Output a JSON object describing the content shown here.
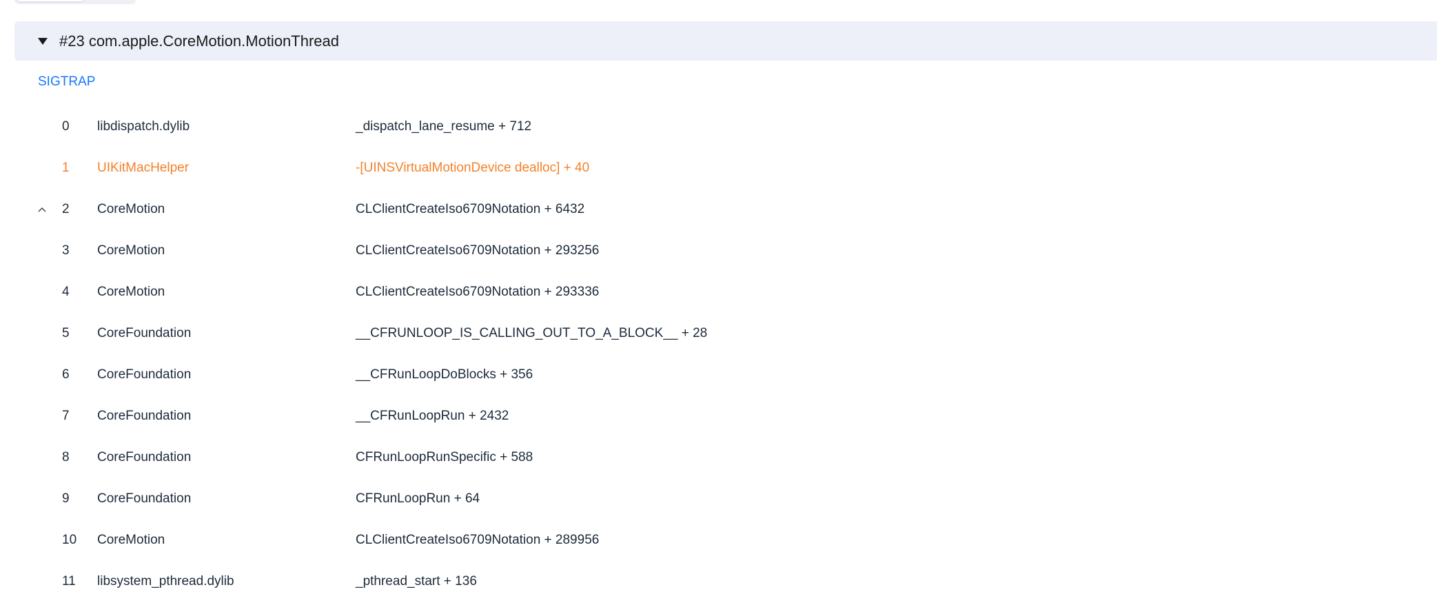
{
  "thread": {
    "title": "#23 com.apple.CoreMotion.MotionThread",
    "signal": "SIGTRAP"
  },
  "colors": {
    "highlight": "#f5812a",
    "link": "#1677ff",
    "header_bg": "#edf0f8"
  },
  "frames": [
    {
      "index": "0",
      "library": "libdispatch.dylib",
      "symbol": "_dispatch_lane_resume + 712"
    },
    {
      "index": "1",
      "library": "UIKitMacHelper",
      "symbol": "-[UINSVirtualMotionDevice dealloc] + 40",
      "highlighted": true
    },
    {
      "index": "2",
      "library": "CoreMotion",
      "symbol": "CLClientCreateIso6709Notation + 6432",
      "collapse_icon": "chevron-up-icon"
    },
    {
      "index": "3",
      "library": "CoreMotion",
      "symbol": "CLClientCreateIso6709Notation + 293256"
    },
    {
      "index": "4",
      "library": "CoreMotion",
      "symbol": "CLClientCreateIso6709Notation + 293336"
    },
    {
      "index": "5",
      "library": "CoreFoundation",
      "symbol": "__CFRUNLOOP_IS_CALLING_OUT_TO_A_BLOCK__ + 28"
    },
    {
      "index": "6",
      "library": "CoreFoundation",
      "symbol": "__CFRunLoopDoBlocks + 356"
    },
    {
      "index": "7",
      "library": "CoreFoundation",
      "symbol": "__CFRunLoopRun + 2432"
    },
    {
      "index": "8",
      "library": "CoreFoundation",
      "symbol": "CFRunLoopRunSpecific + 588"
    },
    {
      "index": "9",
      "library": "CoreFoundation",
      "symbol": "CFRunLoopRun + 64"
    },
    {
      "index": "10",
      "library": "CoreMotion",
      "symbol": "CLClientCreateIso6709Notation + 289956"
    },
    {
      "index": "11",
      "library": "libsystem_pthread.dylib",
      "symbol": "_pthread_start + 136"
    }
  ]
}
